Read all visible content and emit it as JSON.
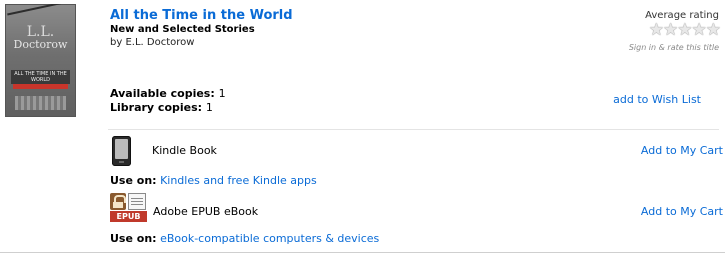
{
  "book": {
    "title": "All the Time in the World",
    "subtitle": "New and Selected Stories",
    "byline_prefix": "by ",
    "author": "E.L. Doctorow",
    "cover": {
      "initials": "L.L.",
      "author_text": "Doctorow",
      "title_text": "ALL THE TIME IN THE WORLD"
    }
  },
  "rating": {
    "label": "Average rating",
    "stars": "★★★★★",
    "value": 0,
    "hint": "Sign in & rate this title"
  },
  "availability": {
    "available_label": "Available copies:",
    "available_count": "1",
    "library_label": "Library copies:",
    "library_count": "1"
  },
  "actions": {
    "wishlist": "add to Wish List"
  },
  "formats": [
    {
      "name": "Kindle Book",
      "icon": "kindle-device-icon",
      "add_to_cart": "Add to My Cart",
      "use_on_label": "Use on:",
      "use_on_link": "Kindles and free Kindle apps"
    },
    {
      "name": "Adobe EPUB eBook",
      "icon": "epub-icon",
      "icon_text": "EPUB",
      "add_to_cart": "Add to My Cart",
      "use_on_label": "Use on:",
      "use_on_link": "eBook-compatible computers & devices"
    }
  ],
  "colors": {
    "link": "#0a6bd6",
    "epub_banner": "#c0392b"
  }
}
